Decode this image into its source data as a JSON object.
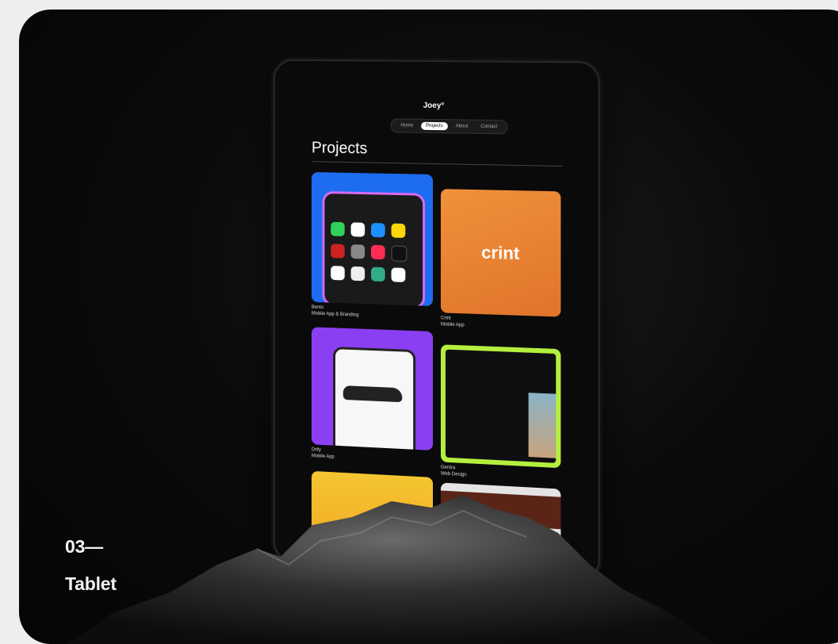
{
  "caption": {
    "number": "03—",
    "title": "Tablet"
  },
  "tablet_screen": {
    "logo": "Joey°",
    "nav": [
      "Home",
      "Projects",
      "About",
      "Contact"
    ],
    "active_nav": "Projects",
    "heading": "Projects",
    "projects": [
      {
        "name": "Bento",
        "type": "Mobile App & Branding"
      },
      {
        "name": "Crint",
        "type": "Mobile App"
      },
      {
        "name": "Drify",
        "type": "Mobile App"
      },
      {
        "name": "Gentra",
        "type": "Web Design"
      }
    ],
    "crint_logo": "crint"
  }
}
